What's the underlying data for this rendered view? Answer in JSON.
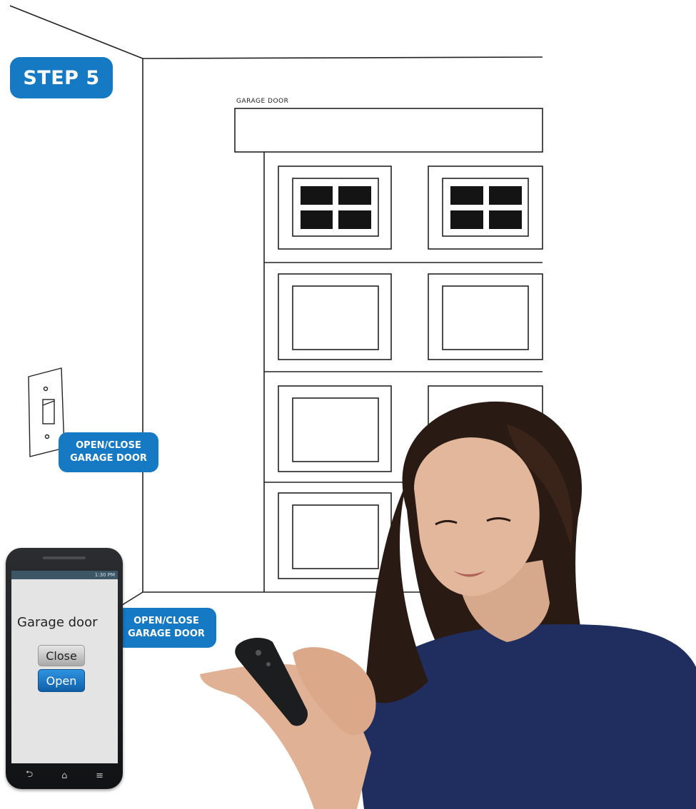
{
  "step": {
    "label": "STEP 5"
  },
  "diagram": {
    "garage_door_label": "GARAGE DOOR"
  },
  "callouts": [
    {
      "line1": "OPEN/CLOSE",
      "line2": "GARAGE DOOR"
    },
    {
      "line1": "OPEN/CLOSE",
      "line2": "GARAGE DOOR"
    }
  ],
  "phone": {
    "status_time": "1:30 PM",
    "app_title": "Garage door",
    "close_label": "Close",
    "open_label": "Open"
  },
  "colors": {
    "accent": "#1579c4",
    "line": "#222222"
  }
}
